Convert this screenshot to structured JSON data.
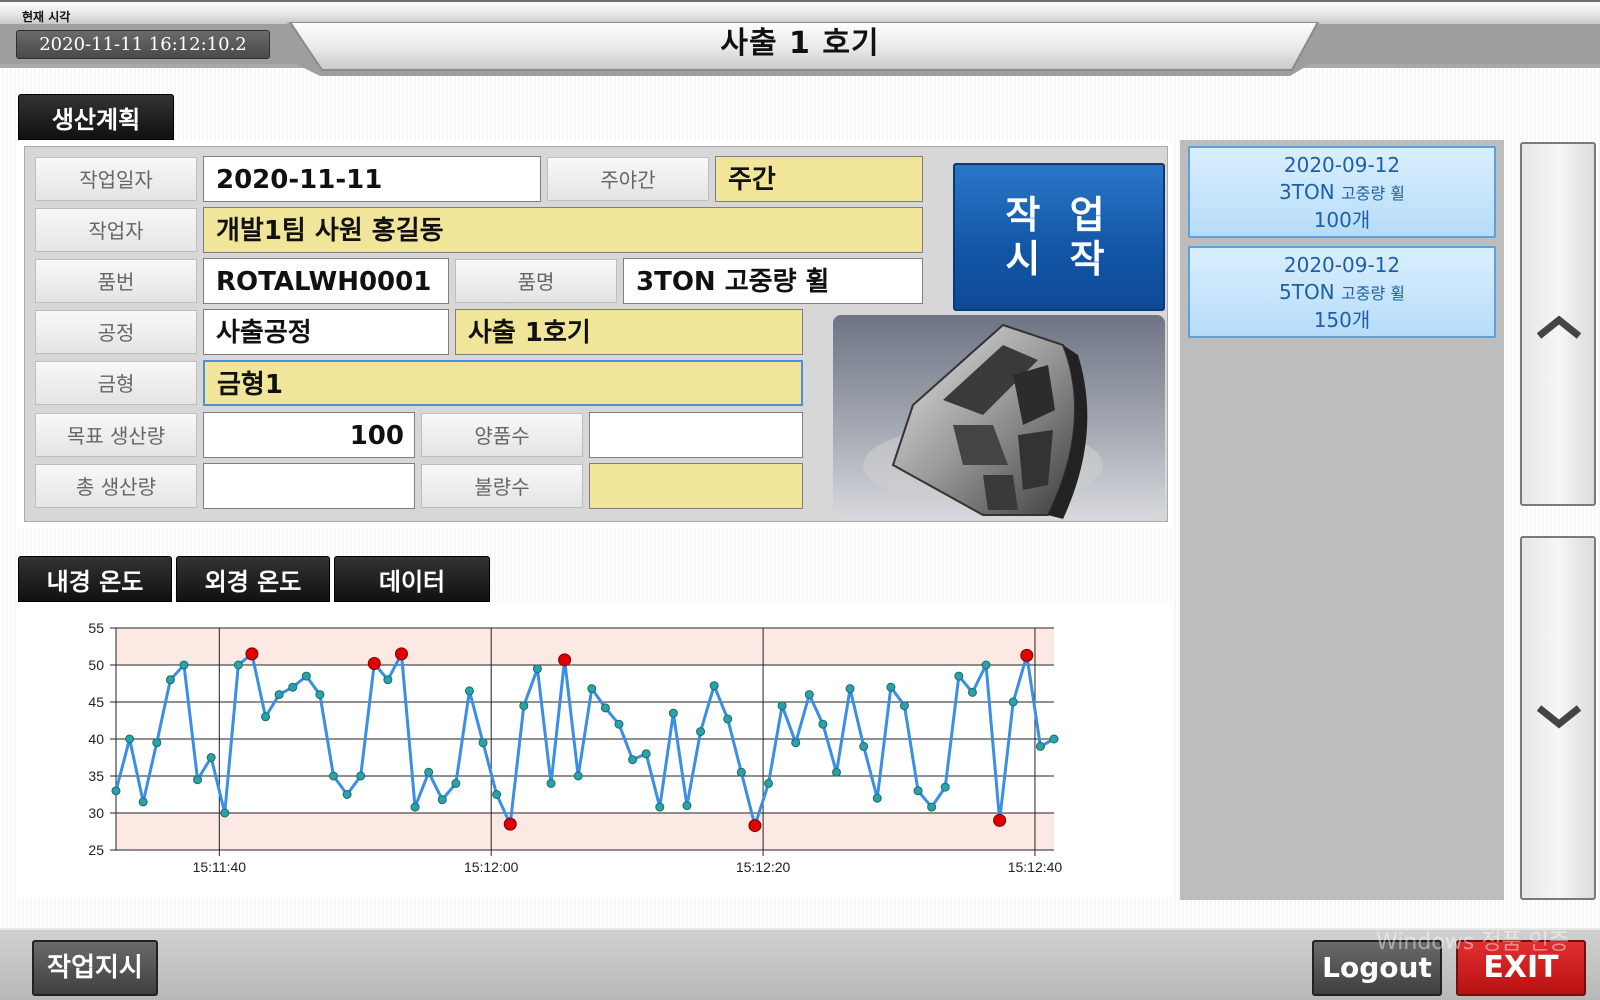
{
  "header": {
    "clock_caption": "현재 시각",
    "clock_value": "2020-11-11 16:12:10.2",
    "title": "사출 1 호기"
  },
  "tabs": {
    "plan": "생산계획",
    "inner_temp": "내경 온도",
    "outer_temp": "외경 온도",
    "data": "데이터"
  },
  "plan": {
    "work_date_label": "작업일자",
    "work_date": "2020-11-11",
    "shift_label": "주야간",
    "shift": "주간",
    "worker_label": "작업자",
    "worker": "개발1팀 사원 홍길동",
    "part_no_label": "품번",
    "part_no": "ROTALWH0001",
    "part_name_label": "품명",
    "part_name": "3TON 고중량 휠",
    "process_label": "공정",
    "process": "사출공정",
    "machine": "사출 1호기",
    "mold_label": "금형",
    "mold": "금형1",
    "target_label": "목표 생산량",
    "target": "100",
    "good_label": "양품수",
    "good": "",
    "total_label": "총 생산량",
    "total": "",
    "defect_label": "불량수",
    "defect": ""
  },
  "start_button": {
    "line1": "작 업",
    "line2": "시 작"
  },
  "orders": [
    {
      "date": "2020-09-12",
      "product": "3TON",
      "desc": "고중량 휠",
      "qty": "100개"
    },
    {
      "date": "2020-09-12",
      "product": "5TON",
      "desc": "고중량 휠",
      "qty": "150개"
    }
  ],
  "footer": {
    "order_button": "작업지시",
    "logout_button": "Logout",
    "exit_button": "EXIT",
    "watermark": "Windows 정품 인증"
  },
  "icons": {
    "scroll_up": "chevron-up-icon",
    "scroll_down": "chevron-down-icon"
  },
  "colors": {
    "accent_blue": "#1255a6",
    "highlight_yellow": "#f1e59a",
    "alarm_red": "#e00000",
    "line_blue": "#3a8ee6"
  },
  "chart_data": {
    "type": "line",
    "title": "",
    "xlabel": "",
    "ylabel": "",
    "ylim": [
      25,
      55
    ],
    "yticks": [
      25,
      30,
      35,
      40,
      45,
      50,
      55
    ],
    "xticks": [
      {
        "t": 7.6,
        "label": "15:11:40"
      },
      {
        "t": 27.6,
        "label": "15:12:00"
      },
      {
        "t": 47.6,
        "label": "15:12:20"
      },
      {
        "t": 67.6,
        "label": "15:12:40"
      }
    ],
    "xlim": [
      0,
      69
    ],
    "normal_band": [
      30,
      50
    ],
    "grid": true,
    "series": [
      {
        "values": [
          33,
          40,
          31.5,
          39.5,
          48,
          50,
          34.5,
          37.5,
          30,
          50,
          51.5,
          43,
          46,
          47,
          48.5,
          46,
          35,
          32.5,
          35,
          50.2,
          48,
          51.5,
          30.8,
          35.5,
          31.8,
          34,
          46.5,
          39.5,
          32.5,
          28.5,
          44.5,
          49.5,
          34,
          50.7,
          35,
          46.8,
          44.2,
          42,
          37.2,
          38,
          30.8,
          43.5,
          31,
          41,
          47.2,
          42.7,
          35.5,
          28.3,
          34,
          44.5,
          39.5,
          46,
          42,
          35.5,
          46.8,
          39,
          32,
          47,
          44.5,
          33,
          30.8,
          33.5,
          48.5,
          46.3,
          50,
          29,
          45,
          51.3,
          39,
          40
        ]
      }
    ]
  }
}
